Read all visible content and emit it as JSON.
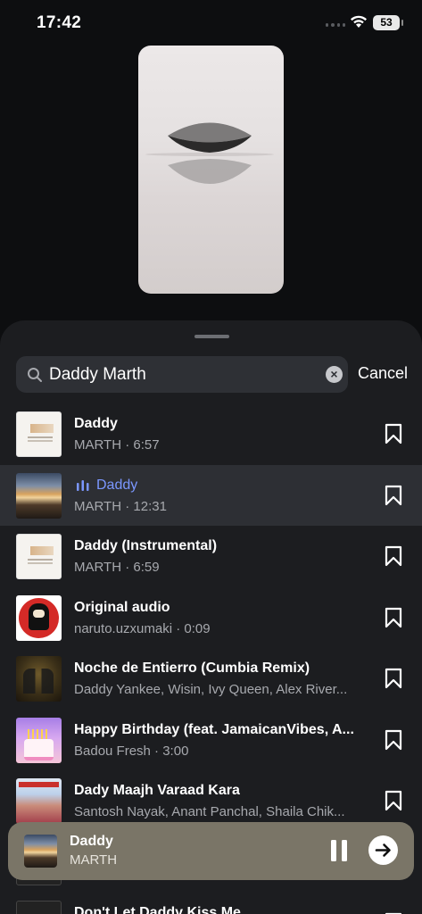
{
  "status_bar": {
    "time": "17:42",
    "battery": "53"
  },
  "search": {
    "query": "Daddy Marth",
    "cancel_label": "Cancel"
  },
  "results": [
    {
      "title": "Daddy",
      "subtitle": "MARTH · 6:57",
      "art": "thumb-doc",
      "playing": false
    },
    {
      "title": "Daddy",
      "subtitle": "MARTH · 12:31",
      "art": "thumb-sunset",
      "playing": true
    },
    {
      "title": "Daddy (Instrumental)",
      "subtitle": "MARTH · 6:59",
      "art": "thumb-doc",
      "playing": false
    },
    {
      "title": "Original audio",
      "subtitle": "naruto.uzxumaki · 0:09",
      "art": "thumb-naruto",
      "playing": false
    },
    {
      "title": "Noche de Entierro (Cumbia Remix)",
      "subtitle": "Daddy Yankee, Wisin, Ivy Queen, Alex River...",
      "art": "thumb-noche",
      "playing": false
    },
    {
      "title": "Happy Birthday (feat. JamaicanVibes, A...",
      "subtitle": "Badou Fresh · 3:00",
      "art": "thumb-bday",
      "playing": false
    },
    {
      "title": "Dady Maajh Varaad Kara",
      "subtitle": "Santosh Nayak, Anant Panchal, Shaila Chik...",
      "art": "thumb-dady",
      "playing": false
    },
    {
      "title": "",
      "subtitle": "",
      "art": "thumb-last",
      "playing": false
    },
    {
      "title": "Don't Let Daddy Kiss Me",
      "subtitle": "",
      "art": "thumb-last",
      "playing": false
    }
  ],
  "mini_player": {
    "title": "Daddy",
    "artist": "MARTH"
  },
  "colors": {
    "accent": "#7b97ff",
    "sheet": "#1c1d20",
    "mini_player": "#7a7567"
  },
  "icons": [
    "search-icon",
    "clear-icon",
    "bookmark-icon",
    "equalizer-icon",
    "pause-icon",
    "arrow-right-icon",
    "wifi-icon",
    "battery-icon"
  ]
}
